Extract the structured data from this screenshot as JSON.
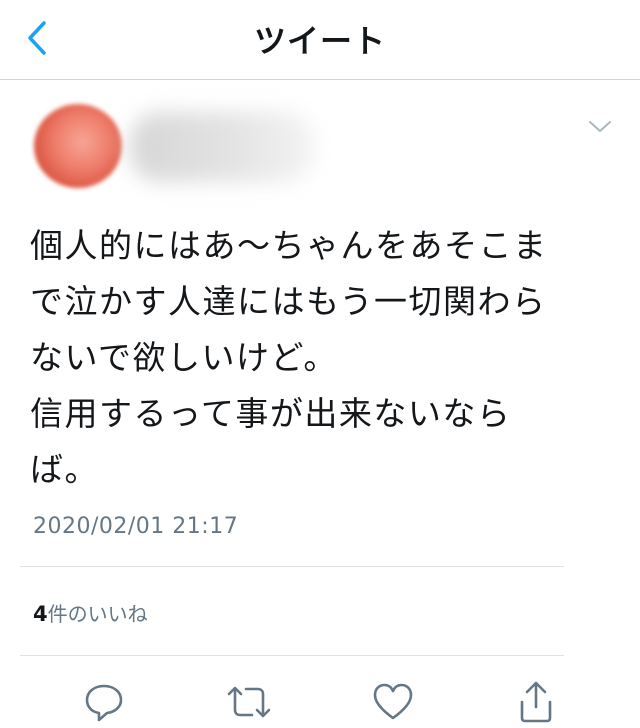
{
  "nav": {
    "title": "ツイート",
    "accent_color": "#1da1f2",
    "back_icon": "chevron-left-icon"
  },
  "tweet": {
    "text": "個人的にはあ〜ちゃんをあそこま\nで泣かす人達にはもう一切関わら\nないで欲しいけど。\n信用するって事が出来ないなら\nば。",
    "timestamp": "2020/02/01 21:17",
    "likes": {
      "count": "4",
      "label": "件のいいね"
    }
  },
  "actions": {
    "icons": [
      "reply-icon",
      "retweet-icon",
      "like-icon",
      "share-icon"
    ],
    "icon_color": "#657786"
  },
  "colors": {
    "text": "#14171a",
    "secondary_text": "#657786",
    "divider": "#dfe3e6"
  }
}
